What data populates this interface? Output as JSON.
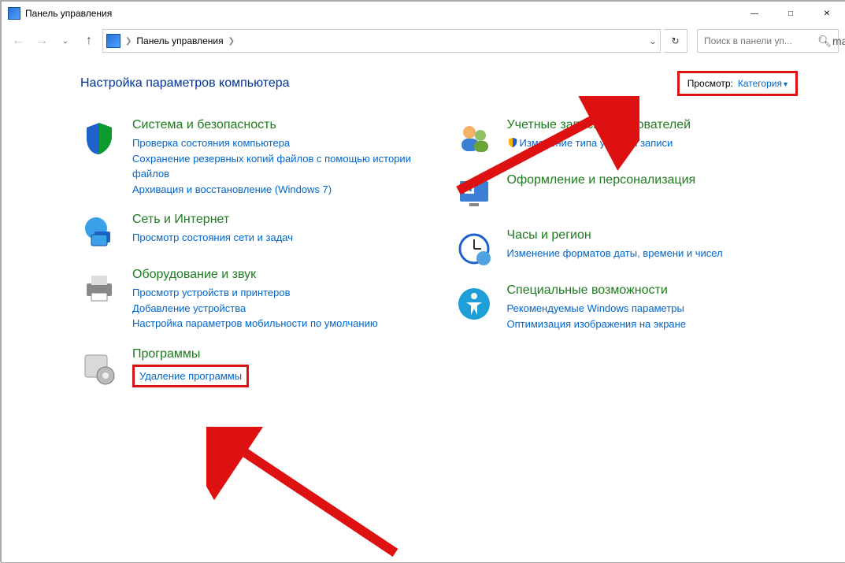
{
  "window": {
    "title": "Панель управления"
  },
  "nav": {
    "breadcrumb_root": "Панель управления",
    "search_placeholder": "Поиск в панели уп..."
  },
  "page": {
    "heading": "Настройка параметров компьютера",
    "view_label": "Просмотр:",
    "view_value": "Категория"
  },
  "left": [
    {
      "title": "Система и безопасность",
      "links": [
        "Проверка состояния компьютера",
        "Сохранение резервных копий файлов с помощью истории файлов",
        "Архивация и восстановление (Windows 7)"
      ]
    },
    {
      "title": "Сеть и Интернет",
      "links": [
        "Просмотр состояния сети и задач"
      ]
    },
    {
      "title": "Оборудование и звук",
      "links": [
        "Просмотр устройств и принтеров",
        "Добавление устройства",
        "Настройка параметров мобильности по умолчанию"
      ]
    },
    {
      "title": "Программы",
      "links": [
        "Удаление программы"
      ]
    }
  ],
  "right": [
    {
      "title": "Учетные записи пользователей",
      "links": [
        "Изменение типа учетной записи"
      ],
      "shield": [
        true
      ]
    },
    {
      "title": "Оформление и персонализация",
      "links": []
    },
    {
      "title": "Часы и регион",
      "links": [
        "Изменение форматов даты, времени и чисел"
      ]
    },
    {
      "title": "Специальные возможности",
      "links": [
        "Рекомендуемые Windows параметры",
        "Оптимизация изображения на экране"
      ]
    }
  ]
}
